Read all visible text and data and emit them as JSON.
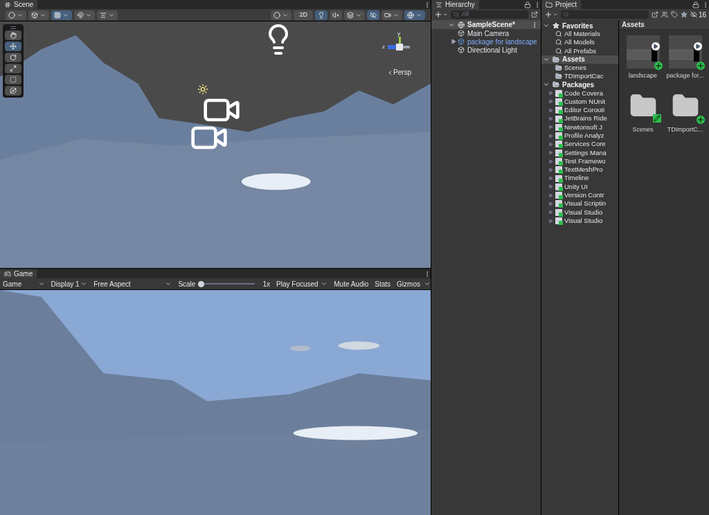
{
  "scene": {
    "tab": "Scene",
    "toolbar": [
      {
        "kind": "dropdown",
        "on": false
      },
      {
        "kind": "dropdown",
        "on": false
      },
      {
        "kind": "dropdown",
        "on": true
      },
      {
        "kind": "dropdown",
        "on": false
      },
      {
        "kind": "dropdown",
        "on": false
      },
      {
        "kind": "dropdown",
        "on": false
      },
      {
        "kind": "text",
        "label": "2D",
        "on": false
      },
      {
        "kind": "button",
        "on": true
      },
      {
        "kind": "button",
        "on": false
      },
      {
        "kind": "dropdown",
        "on": false
      },
      {
        "kind": "button",
        "on": true
      },
      {
        "kind": "dropdown",
        "on": false
      },
      {
        "kind": "dropdown",
        "on": true
      }
    ],
    "tools": [
      {
        "selected": false
      },
      {
        "selected": true
      },
      {
        "selected": false
      },
      {
        "selected": false
      },
      {
        "selected": false
      },
      {
        "selected": false
      }
    ],
    "axes": [
      "y",
      "z"
    ],
    "projection": "Persp"
  },
  "game": {
    "tab": "Game",
    "toolbar": [
      {
        "kind": "dropdown",
        "label": "Game"
      },
      {
        "kind": "dropdown",
        "label": "Display 1"
      },
      {
        "kind": "dropdown",
        "label": "Free Aspect"
      },
      {
        "kind": "slider",
        "label": "Scale",
        "level": 0,
        "reading": "1x"
      },
      {
        "kind": "dropdown",
        "label": "Play Focused"
      },
      {
        "kind": "toggle",
        "label": "Mute Audio",
        "on": false
      },
      {
        "kind": "toggle",
        "label": "Stats",
        "on": false
      },
      {
        "kind": "toggle",
        "label": "Gizmos",
        "on": false
      }
    ]
  },
  "hierarchy": {
    "tab": "Hierarchy",
    "search": {
      "placeholder": "All"
    },
    "scene": {
      "label": "SampleScene*",
      "expanded": true,
      "children": [
        {
          "label": "Main Camera",
          "kind": "object"
        },
        {
          "label": "package for landscape",
          "kind": "prefab"
        },
        {
          "label": "Directional Light",
          "kind": "object"
        }
      ]
    }
  },
  "project": {
    "tab": "Project",
    "hidden_count": "16",
    "tree": [
      {
        "label": "Favorites",
        "kind": "favorites",
        "expanded": true,
        "selected": false,
        "children": [
          {
            "label": "All Materials",
            "kind": "search",
            "selected": false
          },
          {
            "label": "All Models",
            "kind": "search",
            "selected": false
          },
          {
            "label": "All Prefabs",
            "kind": "search",
            "selected": false
          }
        ]
      },
      {
        "label": "Assets",
        "kind": "folder",
        "expanded": true,
        "selected": true,
        "children": [
          {
            "label": "Scenes",
            "kind": "folder",
            "selected": false
          },
          {
            "label": "TDImportCac",
            "kind": "folder",
            "selected": false
          }
        ]
      },
      {
        "label": "Packages",
        "kind": "folder",
        "expanded": true,
        "selected": false,
        "children": [
          {
            "label": "Code Covera",
            "kind": "package",
            "selected": false
          },
          {
            "label": "Custom NUnit",
            "kind": "package",
            "selected": false
          },
          {
            "label": "Editor Corouti",
            "kind": "package",
            "selected": false
          },
          {
            "label": "JetBrains Ride",
            "kind": "package",
            "selected": false
          },
          {
            "label": "Newtonsoft J",
            "kind": "package",
            "selected": false
          },
          {
            "label": "Profile Analyz",
            "kind": "package",
            "selected": false
          },
          {
            "label": "Services Core",
            "kind": "package",
            "selected": false
          },
          {
            "label": "Settings Mana",
            "kind": "package",
            "selected": false
          },
          {
            "label": "Test Framewo",
            "kind": "package",
            "selected": false
          },
          {
            "label": "TextMeshPro",
            "kind": "package",
            "selected": false
          },
          {
            "label": "Timeline",
            "kind": "package",
            "selected": false
          },
          {
            "label": "Unity UI",
            "kind": "package",
            "selected": false
          },
          {
            "label": "Version Contr",
            "kind": "package",
            "selected": false
          },
          {
            "label": "Visual Scriptin",
            "kind": "package",
            "selected": false
          },
          {
            "label": "Visual Studio",
            "kind": "package",
            "selected": false
          },
          {
            "label": "Visual Studio",
            "kind": "package",
            "selected": false
          }
        ]
      }
    ],
    "breadcrumb": "Assets",
    "assets": [
      {
        "label": "landscape",
        "kind": "model",
        "added": true,
        "modified": false
      },
      {
        "label": "package for...",
        "kind": "model",
        "added": true,
        "modified": false
      },
      {
        "label": "Scenes",
        "kind": "folder",
        "added": false,
        "modified": true
      },
      {
        "label": "TDImportC...",
        "kind": "folder",
        "added": true,
        "modified": false
      }
    ]
  }
}
